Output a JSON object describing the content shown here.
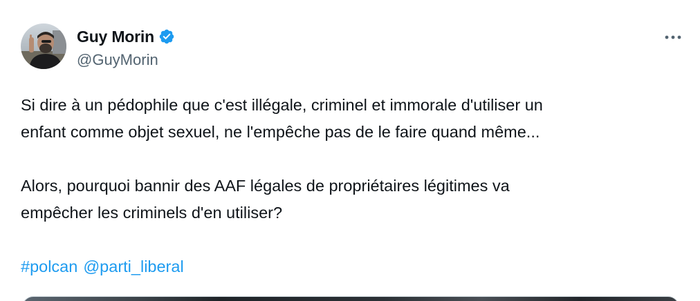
{
  "author": {
    "display_name": "Guy Morin",
    "handle": "@GuyMorin",
    "verified": true,
    "verified_color": "#1d9bf0"
  },
  "menu": {
    "icon": "more-horizontal-icon"
  },
  "tweet": {
    "paragraph_1": "Si dire à un pédophile que c'est illégale, criminel et immorale d'utiliser un\nenfant comme objet sexuel, ne l'empêche pas de le faire quand même...",
    "paragraph_2": "Alors, pourquoi bannir des AAF légales de propriétaires légitimes va\nempêcher les criminels d'en utiliser?",
    "hashtag": "#polcan",
    "mention": "@parti_liberal",
    "link_color": "#1d9bf0"
  }
}
